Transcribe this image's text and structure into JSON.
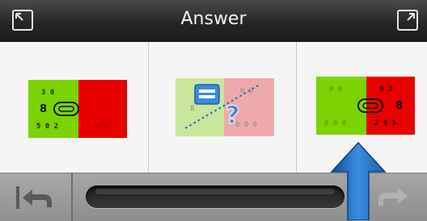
{
  "window": {
    "title": "Answer",
    "left_corner_icon": "collapse-corners-icon",
    "right_corner_icon": "expand-corner-icon"
  },
  "answers": [
    {
      "name": "answer-option-1",
      "icon": "green-red-card-icon",
      "state": "active"
    },
    {
      "name": "answer-option-2",
      "icon": "question-mark-card-icon",
      "state": "faded"
    },
    {
      "name": "answer-option-3",
      "icon": "green-red-card-icon",
      "state": "active"
    }
  ],
  "navigation": {
    "back_icon": "back-arrow-icon",
    "forward_icon": "forward-arrow-icon",
    "progress": 0
  },
  "overlay": {
    "icon": "blue-up-arrow-icon"
  },
  "colors": {
    "green": "#7bd400",
    "red": "#e80000",
    "faded_green": "#c9e79b",
    "faded_red": "#eeaaaa",
    "question_blue": "#3d8ad8",
    "arrow_blue": "#1a5fa8"
  }
}
